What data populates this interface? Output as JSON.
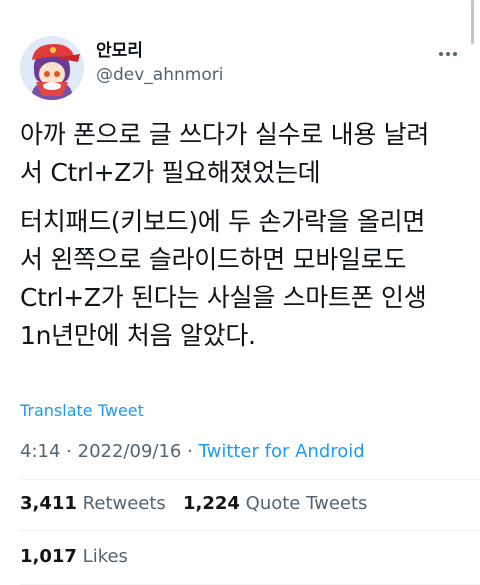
{
  "user": {
    "display_name": "안모리",
    "handle": "@dev_ahnmori"
  },
  "icons": {
    "avatar": "avatar-illustration",
    "more": "more-dots-icon"
  },
  "tweet": {
    "paragraphs": [
      "아까 폰으로 글 쓰다가 실수로 내용 날려\n서 Ctrl+Z가 필요해졌었는데",
      "터치패드(키보드)에 두 손가락을 올리면\n서 왼쪽으로 슬라이드하면 모바일로도\nCtrl+Z가 된다는 사실을 스마트폰 인생\n1n년만에 처음 알았다."
    ],
    "translate_label": "Translate Tweet",
    "time": "4:14",
    "date": "2022/09/16",
    "separator": "·",
    "source": "Twitter for Android"
  },
  "stats": {
    "retweets_count": "3,411",
    "retweets_label": "Retweets",
    "quotes_count": "1,224",
    "quotes_label": "Quote Tweets",
    "likes_count": "1,017",
    "likes_label": "Likes"
  },
  "colors": {
    "link": "#1d9bf0",
    "secondary": "#536471",
    "text": "#0f1419"
  }
}
